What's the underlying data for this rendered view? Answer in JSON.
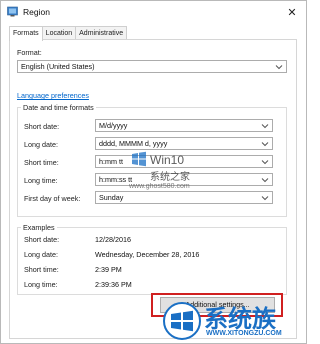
{
  "window": {
    "title": "Region"
  },
  "tabs": [
    "Formats",
    "Location",
    "Administrative"
  ],
  "format": {
    "label": "Format:",
    "value": "English (United States)"
  },
  "language_preferences_link": "Language preferences",
  "date_time_formats": {
    "title": "Date and time formats",
    "rows": [
      {
        "label": "Short date:",
        "value": "M/d/yyyy"
      },
      {
        "label": "Long date:",
        "value": "dddd, MMMM d, yyyy"
      },
      {
        "label": "Short time:",
        "value": "h:mm tt"
      },
      {
        "label": "Long time:",
        "value": "h:mm:ss tt"
      },
      {
        "label": "First day of week:",
        "value": "Sunday"
      }
    ]
  },
  "examples": {
    "title": "Examples",
    "rows": [
      {
        "label": "Short date:",
        "value": "12/28/2016"
      },
      {
        "label": "Long date:",
        "value": "Wednesday, December 28, 2016"
      },
      {
        "label": "Short time:",
        "value": "2:39 PM"
      },
      {
        "label": "Long time:",
        "value": "2:39:36 PM"
      }
    ]
  },
  "additional_settings_button": "Additional settings...",
  "watermark": {
    "center_title": "Win10",
    "center_subtitle": "系统之家",
    "center_url": "www.ghost580.com",
    "bottom_brand": "系统族",
    "bottom_url": "WWW.XITONGZU.COM"
  },
  "colors": {
    "link": "#0066cc",
    "highlight_border": "#d02020",
    "watermark_blue": "#1a6fc4"
  }
}
